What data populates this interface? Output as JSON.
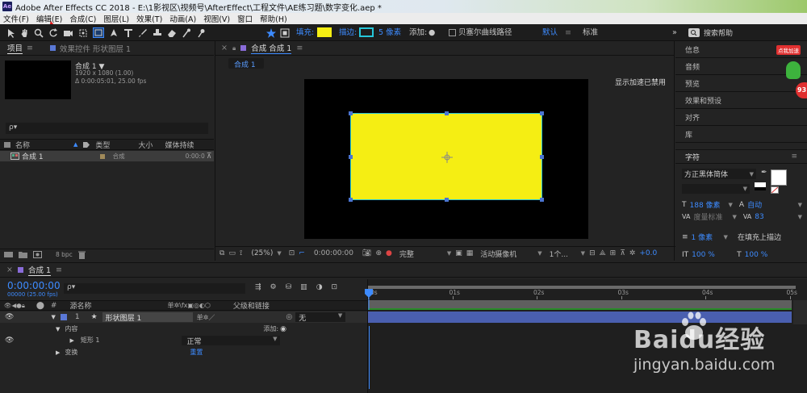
{
  "window": {
    "title": "Adobe After Effects CC 2018 - E:\\1影视区\\视频号\\AfterEffect\\工程文件\\AE练习题\\数字变化.aep *"
  },
  "menu": [
    "文件(F)",
    "编辑(E)",
    "合成(C)",
    "图层(L)",
    "效果(T)",
    "动画(A)",
    "视图(V)",
    "窗口",
    "帮助(H)"
  ],
  "toolbar": {
    "fill_label": "填充:",
    "stroke_label": "描边:",
    "stroke_width": "5 像素",
    "add_label": "添加:",
    "bezier_label": "贝塞尔曲线路径",
    "workspace": "默认",
    "workspace_alt": "标准",
    "search_placeholder": "搜索帮助"
  },
  "colors": {
    "fill": "#f5ee13",
    "stroke": "#26c6d9",
    "accent": "#3d8bff"
  },
  "project": {
    "tab": "项目",
    "effects_tab": "效果控件 形状图层 1",
    "comp_name": "合成 1 ▼",
    "comp_info1": "1920 x 1080 (1.00)",
    "comp_info2": "Δ 0:00:05:01, 25.00 fps",
    "search_placeholder": "ρ▾",
    "headers": [
      "名称",
      "类型",
      "大小",
      "媒体持续"
    ],
    "item_name": "合成 1",
    "item_type": "合成",
    "item_duration": "0:00:0",
    "bpc": "8 bpc"
  },
  "composition": {
    "tab": "合成 合成 1",
    "subtab": "合成 1",
    "gpu_notice": "显示加速已禁用",
    "zoom": "(25%)",
    "timecode": "0:00:00:00",
    "quality": "完整",
    "camera": "活动摄像机",
    "views": "1个...",
    "exposure": "+0.0"
  },
  "right_panels": [
    "信息",
    "音频",
    "预览",
    "效果和预设",
    "对齐",
    "库"
  ],
  "character": {
    "title": "字符",
    "font": "方正黑体简体",
    "font_size": "188 像素",
    "leading": "自动",
    "kerning": "度量标准",
    "tracking": "83",
    "stroke_size": "1 像素",
    "stroke_mode": "在填充上描边",
    "vscale": "100 %",
    "hscale": "100 %"
  },
  "timeline": {
    "tab": "合成 1",
    "timecode": "0:00:00:00",
    "frames": "00000 (25.00 fps)",
    "search_placeholder": "ρ▾",
    "col_source": "源名称",
    "col_switches": "单✲\\fx▣◎◐⬡",
    "col_parent": "父级和链接",
    "layer": {
      "index": "1",
      "name": "形状图层 1",
      "parent": "无"
    },
    "content_label": "内容",
    "add_label": "添加:",
    "rect_label": "矩形 1",
    "rect_mode": "正常",
    "transform_label": "变换",
    "reset_label": "重置",
    "ruler": [
      "0s",
      "01s",
      "02s",
      "03s",
      "04s",
      "05s"
    ]
  },
  "watermark": {
    "brand": "Baidu经验",
    "url": "jingyan.baidu.com"
  },
  "badge": {
    "text": "点我加速",
    "number": "93"
  }
}
